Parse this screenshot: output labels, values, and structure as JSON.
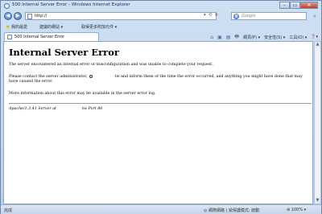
{
  "window": {
    "title": "500 Internal Server Error - Windows Internet Explorer",
    "minimize": "–",
    "maximize": "▭",
    "close": "✕"
  },
  "address_bar": {
    "back": "◀",
    "forward": "▶",
    "url": "http://",
    "tools": [
      "▾",
      "⟲",
      "✕"
    ]
  },
  "search": {
    "engine_initial": "g",
    "placeholder": "Google",
    "go": "⌕"
  },
  "favorites": {
    "star": "★",
    "items": [
      "我的最愛",
      "建議的網站 ▾",
      "取得更多附加元件 ▾"
    ]
  },
  "tab": {
    "label": "500 Internal Server Error"
  },
  "commands": {
    "icons": [
      "⌂",
      "▣",
      "▤",
      "🖶"
    ],
    "items": [
      "網頁(P) ▾",
      "安全性(S) ▾",
      "工具(O) ▾",
      "❓▾"
    ]
  },
  "page": {
    "heading": "Internal Server Error",
    "p1": "The server encountered an internal error or misconfiguration and was unable to complete your request.",
    "p2_start": "Please contact the server administrator,",
    "p2_end": "tw and inform them of the time the error occurred, and anything you might have done that may have caused the error.",
    "p3": "More information about this error may be available in the server error log.",
    "address_left": "Apache/1.3.41 Server at",
    "address_right": "tw Port 80"
  },
  "statusbar": {
    "status": "完成",
    "zone": "網際網路 | 受保護模式: 啟動",
    "zoom": "100%"
  }
}
